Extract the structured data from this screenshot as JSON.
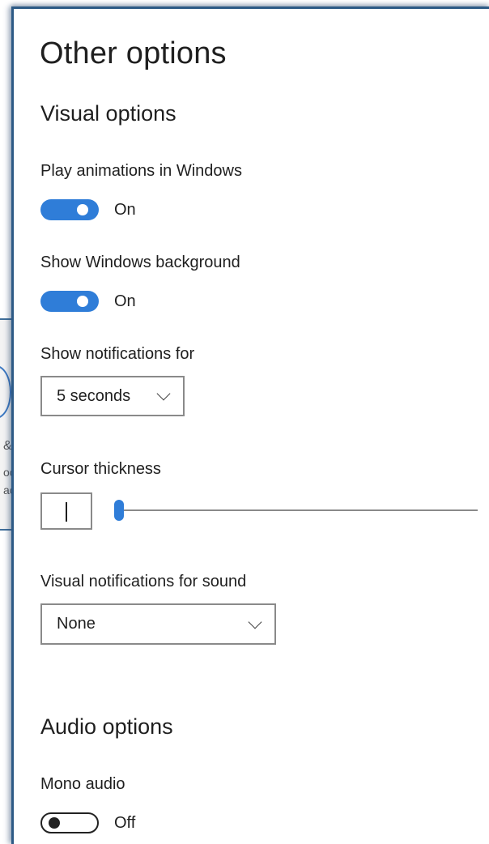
{
  "background_window": {
    "fragments": [
      "&",
      "oo",
      "ac"
    ]
  },
  "panel": {
    "title": "Other options",
    "visual_options": {
      "heading": "Visual options",
      "play_animations": {
        "label": "Play animations in Windows",
        "state": "On",
        "value": true
      },
      "show_background": {
        "label": "Show Windows background",
        "state": "On",
        "value": true
      },
      "notifications": {
        "label": "Show notifications for",
        "selected": "5 seconds"
      },
      "cursor_thickness": {
        "label": "Cursor thickness",
        "value": 1,
        "min": 1,
        "max": 20
      },
      "visual_notifications_sound": {
        "label": "Visual notifications for sound",
        "selected": "None"
      }
    },
    "audio_options": {
      "heading": "Audio options",
      "mono_audio": {
        "label": "Mono audio",
        "state": "Off",
        "value": false
      }
    }
  },
  "colors": {
    "accent": "#2f7dd8",
    "frame": "#2d5a86"
  }
}
